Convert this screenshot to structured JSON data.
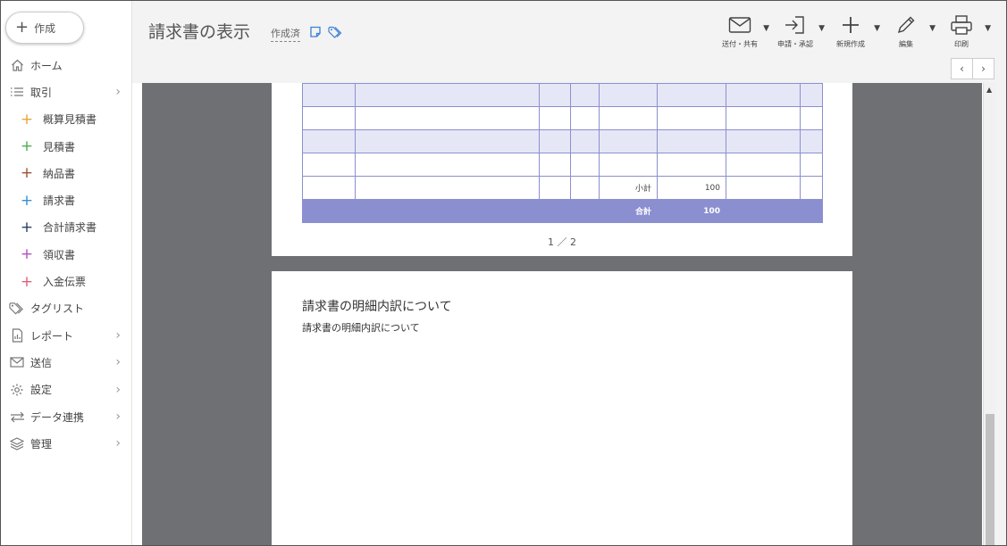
{
  "sidebar": {
    "create_label": "作成",
    "items": [
      {
        "label": "ホーム",
        "icon": "home-icon"
      },
      {
        "label": "取引",
        "icon": "list-icon",
        "chevron": true
      },
      {
        "label": "概算見積書",
        "color": "#e8a53a",
        "sub": true
      },
      {
        "label": "見積書",
        "color": "#4caf50",
        "sub": true
      },
      {
        "label": "納品書",
        "color": "#a0522d",
        "sub": true
      },
      {
        "label": "請求書",
        "color": "#3a8fd0",
        "sub": true
      },
      {
        "label": "合計請求書",
        "color": "#2c3e66",
        "sub": true
      },
      {
        "label": "領収書",
        "color": "#b44fc7",
        "sub": true
      },
      {
        "label": "入金伝票",
        "color": "#e0607a",
        "sub": true
      },
      {
        "label": "タグリスト",
        "icon": "tag-icon"
      },
      {
        "label": "レポート",
        "icon": "report-icon",
        "chevron": true
      },
      {
        "label": "送信",
        "icon": "mail-icon",
        "chevron": true
      },
      {
        "label": "設定",
        "icon": "gear-icon",
        "chevron": true
      },
      {
        "label": "データ連携",
        "icon": "sync-icon",
        "chevron": true
      },
      {
        "label": "管理",
        "icon": "layers-icon",
        "chevron": true
      }
    ]
  },
  "header": {
    "title": "請求書の表示",
    "status": "作成済",
    "toolbar": [
      {
        "label": "送付・共有",
        "icon": "mail-icon"
      },
      {
        "label": "申請・承認",
        "icon": "login-icon"
      },
      {
        "label": "新規作成",
        "icon": "plus-icon"
      },
      {
        "label": "編集",
        "icon": "pencil-icon"
      },
      {
        "label": "印刷",
        "icon": "printer-icon"
      }
    ],
    "pager": {
      "prev": "‹",
      "next": "›"
    }
  },
  "document": {
    "table": {
      "rows": [
        {
          "shade": true,
          "cells": [
            "",
            "",
            "",
            "",
            "",
            "",
            "",
            ""
          ]
        },
        {
          "shade": false,
          "cells": [
            "",
            "",
            "",
            "",
            "",
            "",
            "",
            ""
          ]
        },
        {
          "shade": true,
          "cells": [
            "",
            "",
            "",
            "",
            "",
            "",
            "",
            ""
          ]
        },
        {
          "shade": false,
          "cells": [
            "",
            "",
            "",
            "",
            "",
            "",
            "",
            ""
          ]
        },
        {
          "shade": false,
          "cells": [
            "",
            "",
            "",
            "",
            "小計",
            "100",
            "",
            ""
          ]
        },
        {
          "shade": false,
          "total": true,
          "cells": [
            "",
            "",
            "",
            "",
            "合計",
            "100",
            "",
            ""
          ]
        }
      ]
    },
    "page_number": "1 ／ 2",
    "section_title": "請求書の明細内訳について",
    "section_body": "請求書の明細内訳について"
  },
  "colors": {
    "accent": "#3b7fd6",
    "table_border": "#8b8fd0",
    "table_shade": "#e6e7f6",
    "viewer_bg": "#6e7073"
  }
}
